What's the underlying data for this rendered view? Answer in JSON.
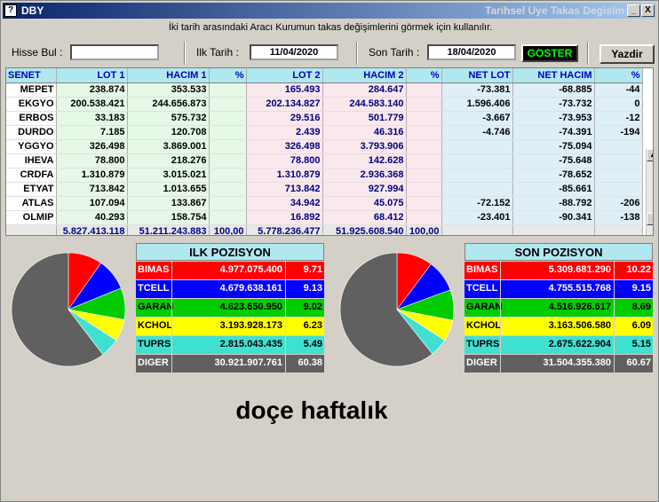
{
  "window": {
    "icon_text": "?",
    "app_title": "DBY",
    "right_title": "Tarihsel Uye Takas Degisim",
    "min_btn": "_",
    "close_btn": "X"
  },
  "info_text": "İki tarih arasındaki Aracı Kurumun takas değişimlerini görmek için kullanılır.",
  "filters": {
    "hisse_label": "Hisse Bul :",
    "hisse_value": "",
    "ilk_label": "Ilk Tarih :",
    "ilk_value": "11/04/2020",
    "son_label": "Son Tarih :",
    "son_value": "18/04/2020",
    "goster_label": "GOSTER",
    "yazdir_label": "Yazdir"
  },
  "table": {
    "headers": [
      "SENET",
      "LOT 1",
      "HACIM 1",
      "%",
      "LOT 2",
      "HACIM 2",
      "%",
      "NET LOT",
      "NET HACIM",
      "%"
    ],
    "rows": [
      [
        "MEPET",
        "238.874",
        "353.533",
        "",
        "165.493",
        "284.647",
        "",
        "-73.381",
        "-68.885",
        "-44"
      ],
      [
        "EKGYO",
        "200.538.421",
        "244.656.873",
        "",
        "202.134.827",
        "244.583.140",
        "",
        "1.596.406",
        "-73.732",
        "0"
      ],
      [
        "ERBOS",
        "33.183",
        "575.732",
        "",
        "29.516",
        "501.779",
        "",
        "-3.667",
        "-73.953",
        "-12"
      ],
      [
        "DURDO",
        "7.185",
        "120.708",
        "",
        "2.439",
        "46.316",
        "",
        "-4.746",
        "-74.391",
        "-194"
      ],
      [
        "YGGYO",
        "326.498",
        "3.869.001",
        "",
        "326.498",
        "3.793.906",
        "",
        "",
        "-75.094",
        ""
      ],
      [
        "IHEVA",
        "78.800",
        "218.276",
        "",
        "78.800",
        "142.628",
        "",
        "",
        "-75.648",
        ""
      ],
      [
        "CRDFA",
        "1.310.879",
        "3.015.021",
        "",
        "1.310.879",
        "2.936.368",
        "",
        "",
        "-78.652",
        ""
      ],
      [
        "ETYAT",
        "713.842",
        "1.013.655",
        "",
        "713.842",
        "927.994",
        "",
        "",
        "-85.661",
        ""
      ],
      [
        "ATLAS",
        "107.094",
        "133.867",
        "",
        "34.942",
        "45.075",
        "",
        "-72.152",
        "-88.792",
        "-206"
      ],
      [
        "OLMIP",
        "40.293",
        "158.754",
        "",
        "16.892",
        "68.412",
        "",
        "-23.401",
        "-90.341",
        "-138"
      ]
    ],
    "totals": [
      "",
      "5.827.413.118",
      "51.211.243.883",
      "100,00",
      "5.778.236.477",
      "51.925.608.540",
      "100,00",
      "",
      "",
      ""
    ]
  },
  "ilk_pozisyon": {
    "title": "ILK POZISYON",
    "rows": [
      {
        "name": "BIMAS",
        "value": "4.977.075.400",
        "pct": "9.71"
      },
      {
        "name": "TCELL",
        "value": "4.679.638.161",
        "pct": "9.13"
      },
      {
        "name": "GARAN",
        "value": "4.623.650.950",
        "pct": "9.02"
      },
      {
        "name": "KCHOL",
        "value": "3.193.928.173",
        "pct": "6.23"
      },
      {
        "name": "TUPRS",
        "value": "2.815.043.435",
        "pct": "5.49"
      },
      {
        "name": "DIGER",
        "value": "30.921.907.761",
        "pct": "60.38"
      }
    ]
  },
  "son_pozisyon": {
    "title": "SON POZISYON",
    "rows": [
      {
        "name": "BIMAS",
        "value": "5.309.681.290",
        "pct": "10.22"
      },
      {
        "name": "TCELL",
        "value": "4.755.515.768",
        "pct": "9.15"
      },
      {
        "name": "GARAN",
        "value": "4.516.926.617",
        "pct": "8.69"
      },
      {
        "name": "KCHOL",
        "value": "3.163.506.580",
        "pct": "6.09"
      },
      {
        "name": "TUPRS",
        "value": "2.675.622.904",
        "pct": "5.15"
      },
      {
        "name": "DIGER",
        "value": "31.504.355.380",
        "pct": "60.67"
      }
    ]
  },
  "chart_data": [
    {
      "type": "pie",
      "categories": [
        "BIMAS",
        "TCELL",
        "GARAN",
        "KCHOL",
        "TUPRS",
        "DIGER"
      ],
      "values": [
        9.71,
        9.13,
        9.02,
        6.23,
        5.49,
        60.38
      ],
      "colors": [
        "#ff0000",
        "#0000ff",
        "#00cc00",
        "#ffff00",
        "#40e0d0",
        "#606060"
      ]
    },
    {
      "type": "pie",
      "categories": [
        "BIMAS",
        "TCELL",
        "GARAN",
        "KCHOL",
        "TUPRS",
        "DIGER"
      ],
      "values": [
        10.22,
        9.15,
        8.69,
        6.09,
        5.15,
        60.67
      ],
      "colors": [
        "#ff0000",
        "#0000ff",
        "#00cc00",
        "#ffff00",
        "#40e0d0",
        "#606060"
      ]
    }
  ],
  "caption": "doçe haftalık",
  "icons": {
    "scroll_up": "up-arrow-icon",
    "scroll_down": "down-arrow-icon"
  }
}
